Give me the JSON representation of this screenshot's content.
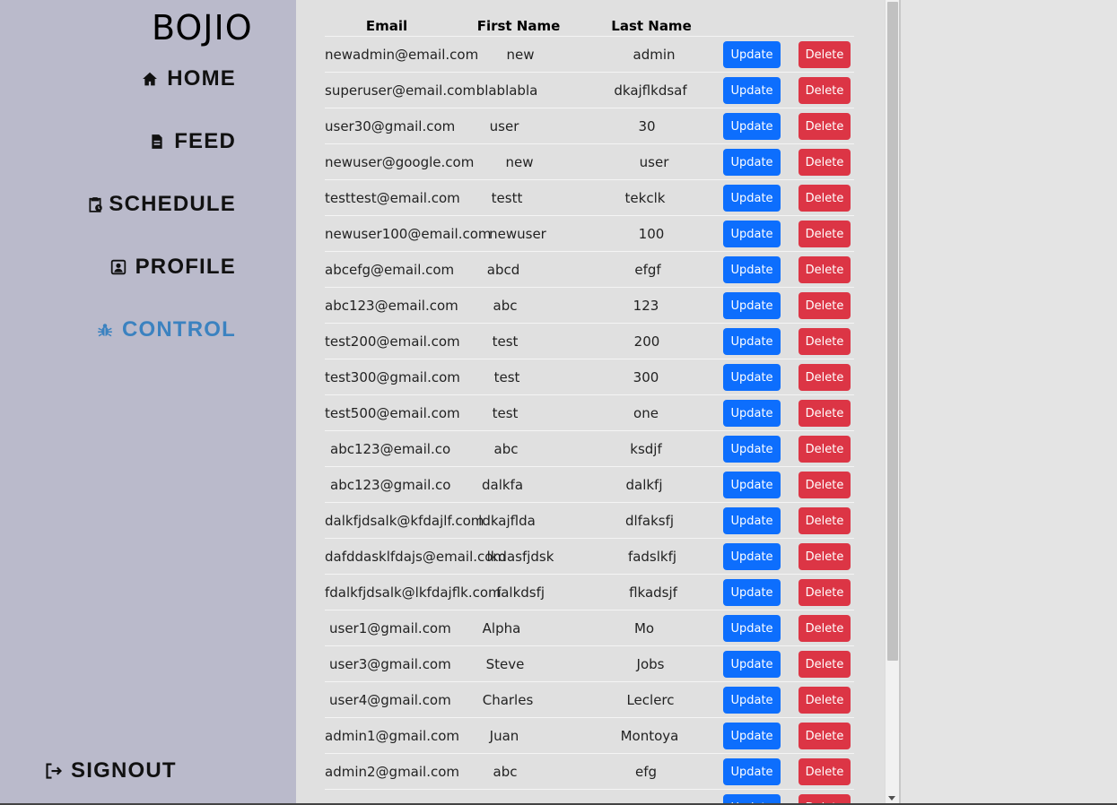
{
  "sidebar": {
    "brand": "BOJIO",
    "items": [
      {
        "label": "HOME",
        "icon": "home-icon"
      },
      {
        "label": "FEED",
        "icon": "document-icon"
      },
      {
        "label": "SCHEDULE",
        "icon": "clipboard-clock-icon"
      },
      {
        "label": "PROFILE",
        "icon": "person-badge-icon"
      },
      {
        "label": "CONTROL",
        "icon": "bug-icon",
        "active": true
      }
    ],
    "signout": {
      "label": "SIGNOUT",
      "icon": "sign-out-icon"
    }
  },
  "table": {
    "headers": [
      "Email",
      "First Name",
      "Last Name"
    ],
    "update_label": "Update",
    "delete_label": "Delete",
    "rows": [
      {
        "email": "newadmin@email.com",
        "first": "new",
        "last": "admin"
      },
      {
        "email": "superuser@email.com",
        "first": "blablabla",
        "last": "dkajflkdsaf"
      },
      {
        "email": "user30@gmail.com",
        "first": "user",
        "last": "30"
      },
      {
        "email": "newuser@google.com",
        "first": "new",
        "last": "user"
      },
      {
        "email": "testtest@email.com",
        "first": "testt",
        "last": "tekclk"
      },
      {
        "email": "newuser100@email.com",
        "first": "newuser",
        "last": "100"
      },
      {
        "email": "abcefg@email.com",
        "first": "abcd",
        "last": "efgf"
      },
      {
        "email": "abc123@email.com",
        "first": "abc",
        "last": "123"
      },
      {
        "email": "test200@email.com",
        "first": "test",
        "last": "200"
      },
      {
        "email": "test300@gmail.com",
        "first": "test",
        "last": "300"
      },
      {
        "email": "test500@email.com",
        "first": "test",
        "last": "one"
      },
      {
        "email": "abc123@email.co",
        "first": "abc",
        "last": "ksdjf"
      },
      {
        "email": "abc123@gmail.co",
        "first": "dalkfa",
        "last": "dalkfj"
      },
      {
        "email": "dalkfjdsalk@kfdajlf.com",
        "first": "ldkajflda",
        "last": "dlfaksfj"
      },
      {
        "email": "dafddasklfdajs@email.com",
        "first": "lkdasfjdsk",
        "last": "fadslkfj"
      },
      {
        "email": "fdalkfjdsalk@lkfdajflk.com",
        "first": "falkdsfj",
        "last": "flkadsjf"
      },
      {
        "email": "user1@gmail.com",
        "first": "Alpha",
        "last": "Mo"
      },
      {
        "email": "user3@gmail.com",
        "first": "Steve",
        "last": "Jobs"
      },
      {
        "email": "user4@gmail.com",
        "first": "Charles",
        "last": "Leclerc"
      },
      {
        "email": "admin1@gmail.com",
        "first": "Juan",
        "last": "Montoya"
      },
      {
        "email": "admin2@gmail.com",
        "first": "abc",
        "last": "efg"
      },
      {
        "email": "",
        "first": "",
        "last": ""
      }
    ]
  },
  "colors": {
    "sidebar_bg": "#babacb",
    "active_nav": "#3b82c0",
    "update_btn": "#0d6efd",
    "delete_btn": "#dc3545"
  }
}
